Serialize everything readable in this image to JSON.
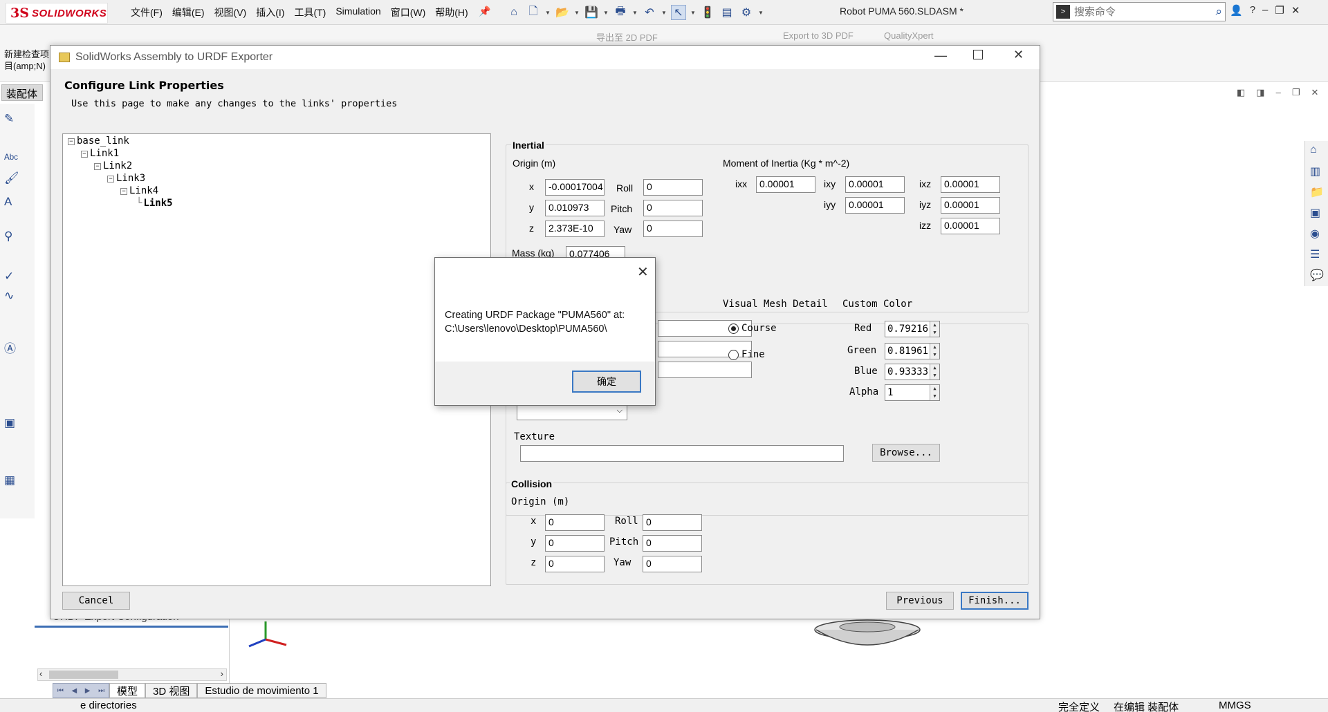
{
  "app": {
    "brand_ds": "3S",
    "brand_name": "SOLIDWORKS",
    "menu": [
      "文件(F)",
      "编辑(E)",
      "视图(V)",
      "插入(I)",
      "工具(T)",
      "Simulation",
      "窗口(W)",
      "帮助(H)"
    ],
    "document_title": "Robot PUMA 560.SLDASM *",
    "search_placeholder": "搜索命令",
    "new_check_line1": "新建检查项",
    "new_check_line2": "目(amp;N)",
    "export_2d_pdf": "导出至 2D PDF",
    "export_3d_pdf": "Export to 3D PDF",
    "qualityxpert": "QualityXpert",
    "assembly_tab": "装配体",
    "tree_config": "URDF Export Configuration",
    "bottom_tabs": [
      "模型",
      "3D 视图",
      "Estudio de movimiento 1"
    ],
    "status_directories": "e directories",
    "status_fully_defined": "完全定义",
    "status_editing": "在编辑 装配体",
    "status_units": "MMGS"
  },
  "exporter": {
    "window_title": "SolidWorks Assembly to URDF Exporter",
    "page_title": "Configure Link Properties",
    "page_description": "Use this page to make any changes to the links' properties",
    "tree": [
      "base_link",
      "Link1",
      "Link2",
      "Link3",
      "Link4",
      "Link5"
    ],
    "inertial": {
      "group_label": "Inertial",
      "origin_label": "Origin (m)",
      "x_label": "x",
      "y_label": "y",
      "z_label": "z",
      "roll_label": "Roll",
      "pitch_label": "Pitch",
      "yaw_label": "Yaw",
      "x": "-0.00017004",
      "y": "0.010973",
      "z": "2.373E-10",
      "roll": "0",
      "pitch": "0",
      "yaw": "0",
      "moi_label": "Moment of Inertia (Kg * m^-2)",
      "ixx_label": "ixx",
      "ixy_label": "ixy",
      "ixz_label": "ixz",
      "iyy_label": "iyy",
      "iyz_label": "iyz",
      "izz_label": "izz",
      "ixx": "0.00001",
      "ixy": "0.00001",
      "ixz": "0.00001",
      "iyy": "0.00001",
      "iyz": "0.00001",
      "izz": "0.00001",
      "mass_label": "Mass (kg)",
      "mass": "0.077406"
    },
    "visual": {
      "mesh_detail_label": "Visual Mesh Detail",
      "course_label": "Course",
      "fine_label": "Fine",
      "custom_color_label": "Custom Color",
      "red_label": "Red",
      "green_label": "Green",
      "blue_label": "Blue",
      "alpha_label": "Alpha",
      "red": "0.79216",
      "green": "0.81961",
      "blue": "0.93333",
      "alpha": "1",
      "texture_label": "Texture",
      "texture": "",
      "browse_label": "Browse..."
    },
    "collision": {
      "group_label": "Collision",
      "origin_label": "Origin (m)",
      "x_label": "x",
      "y_label": "y",
      "z_label": "z",
      "roll_label": "Roll",
      "pitch_label": "Pitch",
      "yaw_label": "Yaw",
      "x": "0",
      "y": "0",
      "z": "0",
      "roll": "0",
      "pitch": "0",
      "yaw": "0"
    },
    "buttons": {
      "cancel": "Cancel",
      "previous": "Previous",
      "finish": "Finish..."
    }
  },
  "dialog": {
    "message_line1": "Creating URDF Package \"PUMA560\" at:",
    "message_line2": "C:\\Users\\lenovo\\Desktop\\PUMA560\\",
    "ok_label": "确定"
  }
}
